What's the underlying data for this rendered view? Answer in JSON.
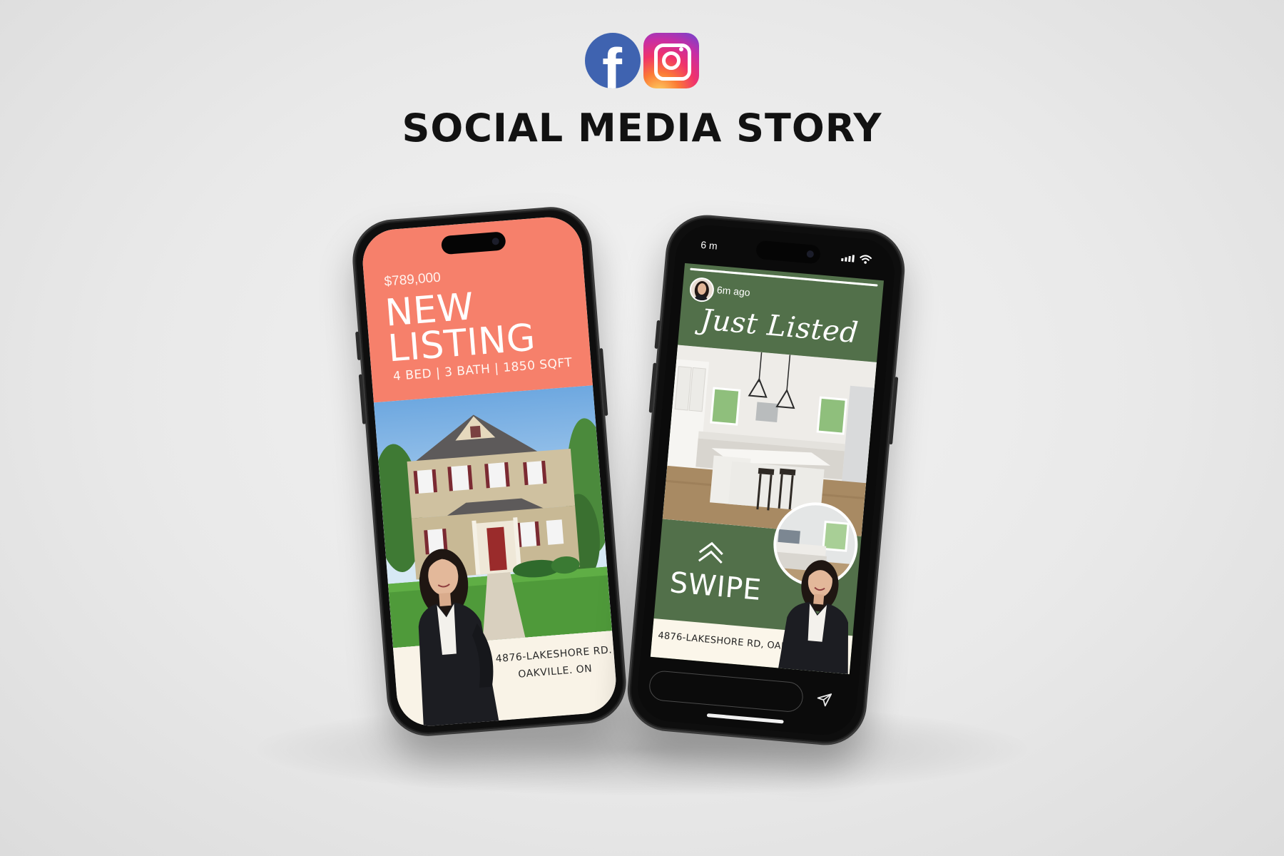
{
  "header": {
    "facebook_letter": "f",
    "title": "SOCIAL MEDIA STORY"
  },
  "icons": [
    "facebook-icon",
    "instagram-icon",
    "swipe-up-chevron-icon",
    "send-icon",
    "signal-icon",
    "wifi-icon"
  ],
  "left_phone": {
    "price": "$789,000",
    "headline_line1": "NEW",
    "headline_line2": "LISTING",
    "specs": "4 BED | 3 BATH | 1850 SQFT",
    "address_line1": "4876-LAKESHORE RD.",
    "address_line2": "OAKVILLE. ON"
  },
  "right_phone": {
    "status_time": "6 m",
    "time_ago": "6m ago",
    "script_title": "Just Listed",
    "swipe_label": "SWIPE",
    "address": "4876-LAKESHORE RD, OAKVILLE. ON",
    "story_progress": 1.0
  },
  "colors": {
    "coral": "#f6806b",
    "story_green": "#52704a",
    "cream": "#f9f3e7",
    "facebook_blue": "#3f63b0"
  }
}
